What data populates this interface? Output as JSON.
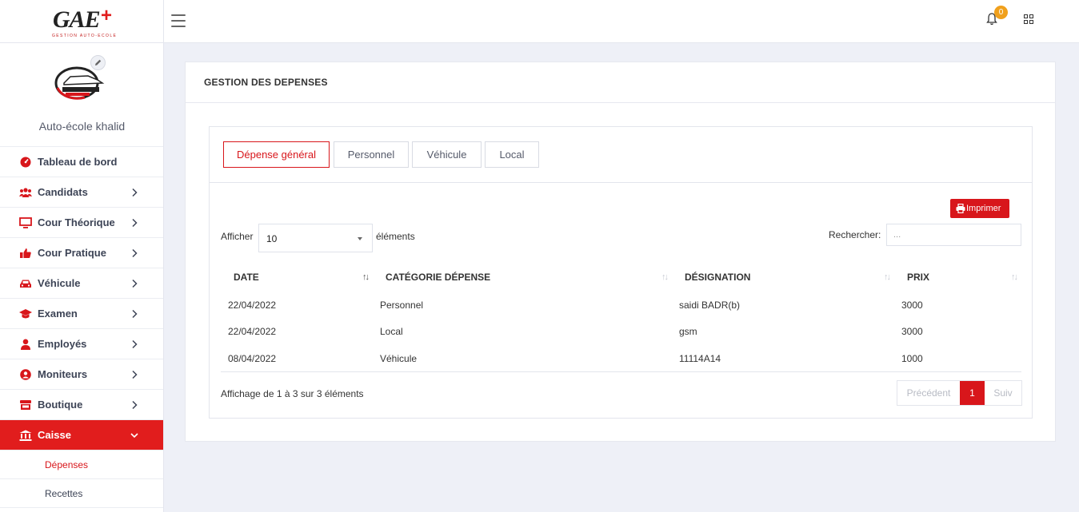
{
  "brand": {
    "logo_text": "GAE",
    "logo_sub": "GESTION AUTO-ECOLE"
  },
  "topbar": {
    "notification_count": "0"
  },
  "sidebar": {
    "school_name": "Auto-école khalid",
    "items": [
      {
        "label": "Tableau de bord",
        "icon": "dashboard-icon"
      },
      {
        "label": "Candidats",
        "icon": "users-icon"
      },
      {
        "label": "Cour Théorique",
        "icon": "monitor-icon"
      },
      {
        "label": "Cour Pratique",
        "icon": "thumbs-up-icon"
      },
      {
        "label": "Véhicule",
        "icon": "car-icon"
      },
      {
        "label": "Examen",
        "icon": "graduation-cap-icon"
      },
      {
        "label": "Employés",
        "icon": "user-icon"
      },
      {
        "label": "Moniteurs",
        "icon": "user-circle-icon"
      },
      {
        "label": "Boutique",
        "icon": "store-icon"
      },
      {
        "label": "Caisse",
        "icon": "bank-icon"
      }
    ],
    "subitems": [
      {
        "label": "Dépenses"
      },
      {
        "label": "Recettes"
      }
    ]
  },
  "card": {
    "title": "GESTION DES DEPENSES"
  },
  "tabs": [
    {
      "label": "Dépense général"
    },
    {
      "label": "Personnel"
    },
    {
      "label": "Véhicule"
    },
    {
      "label": "Local"
    }
  ],
  "toolbar": {
    "print_label": "Imprimer",
    "show_label": "Afficher",
    "page_size": "10",
    "elements_label": "éléments",
    "search_label": "Rechercher:",
    "search_placeholder": "..."
  },
  "table": {
    "columns": [
      "DATE",
      "CATÉGORIE DÉPENSE",
      "DÉSIGNATION",
      "PRIX"
    ],
    "rows": [
      [
        "22/04/2022",
        "Personnel",
        "saidi BADR(b)",
        "3000"
      ],
      [
        "22/04/2022",
        "Local",
        "gsm",
        "3000"
      ],
      [
        "08/04/2022",
        "Véhicule",
        "11114A14",
        "1000"
      ]
    ]
  },
  "footer": {
    "info": "Affichage de 1 à 3 sur 3 éléments",
    "prev_label": "Précédent",
    "current_page": "1",
    "next_label": "Suiv"
  },
  "colors": {
    "accent": "#d8161b",
    "badge": "#f0a01c",
    "background": "#eef0f7"
  }
}
